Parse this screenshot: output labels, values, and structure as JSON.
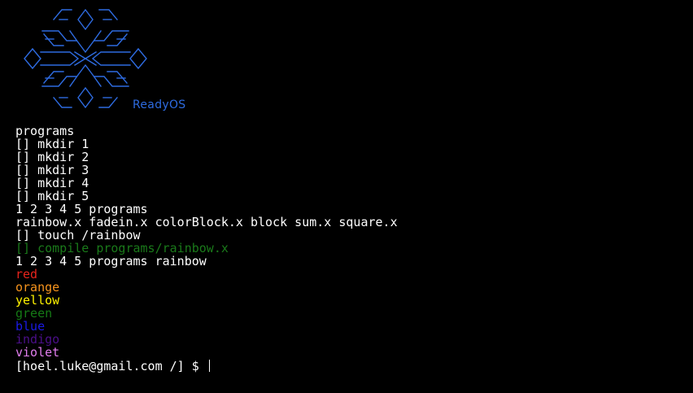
{
  "header": {
    "brand": "ReadyOS",
    "logo_icon": "snowflake-logo-icon",
    "logo_color": "#2e6be0"
  },
  "terminal": {
    "lines": [
      {
        "text": "programs",
        "color": "#ffffff"
      },
      {
        "text": "[] mkdir 1",
        "color": "#ffffff"
      },
      {
        "text": "[] mkdir 2",
        "color": "#ffffff"
      },
      {
        "text": "[] mkdir 3",
        "color": "#ffffff"
      },
      {
        "text": "[] mkdir 4",
        "color": "#ffffff"
      },
      {
        "text": "[] mkdir 5",
        "color": "#ffffff"
      },
      {
        "text": "1 2 3 4 5 programs",
        "color": "#ffffff"
      },
      {
        "text": "rainbow.x fadein.x colorBlock.x block sum.x square.x",
        "color": "#ffffff"
      },
      {
        "text": "[] touch /rainbow",
        "color": "#ffffff"
      },
      {
        "text": "[] compile programs/rainbow.x",
        "color": "#1a7a1a"
      },
      {
        "text": "1 2 3 4 5 programs rainbow",
        "color": "#ffffff"
      },
      {
        "text": "red",
        "color": "#e8241c"
      },
      {
        "text": "orange",
        "color": "#f7941d"
      },
      {
        "text": "yellow",
        "color": "#fff200"
      },
      {
        "text": "green",
        "color": "#157a15"
      },
      {
        "text": "blue",
        "color": "#1a1ae6"
      },
      {
        "text": "indigo",
        "color": "#4b0f8a"
      },
      {
        "text": "violet",
        "color": "#e27ef0"
      }
    ],
    "prompt": "[hoel.luke@gmail.com /] $",
    "input_value": ""
  }
}
